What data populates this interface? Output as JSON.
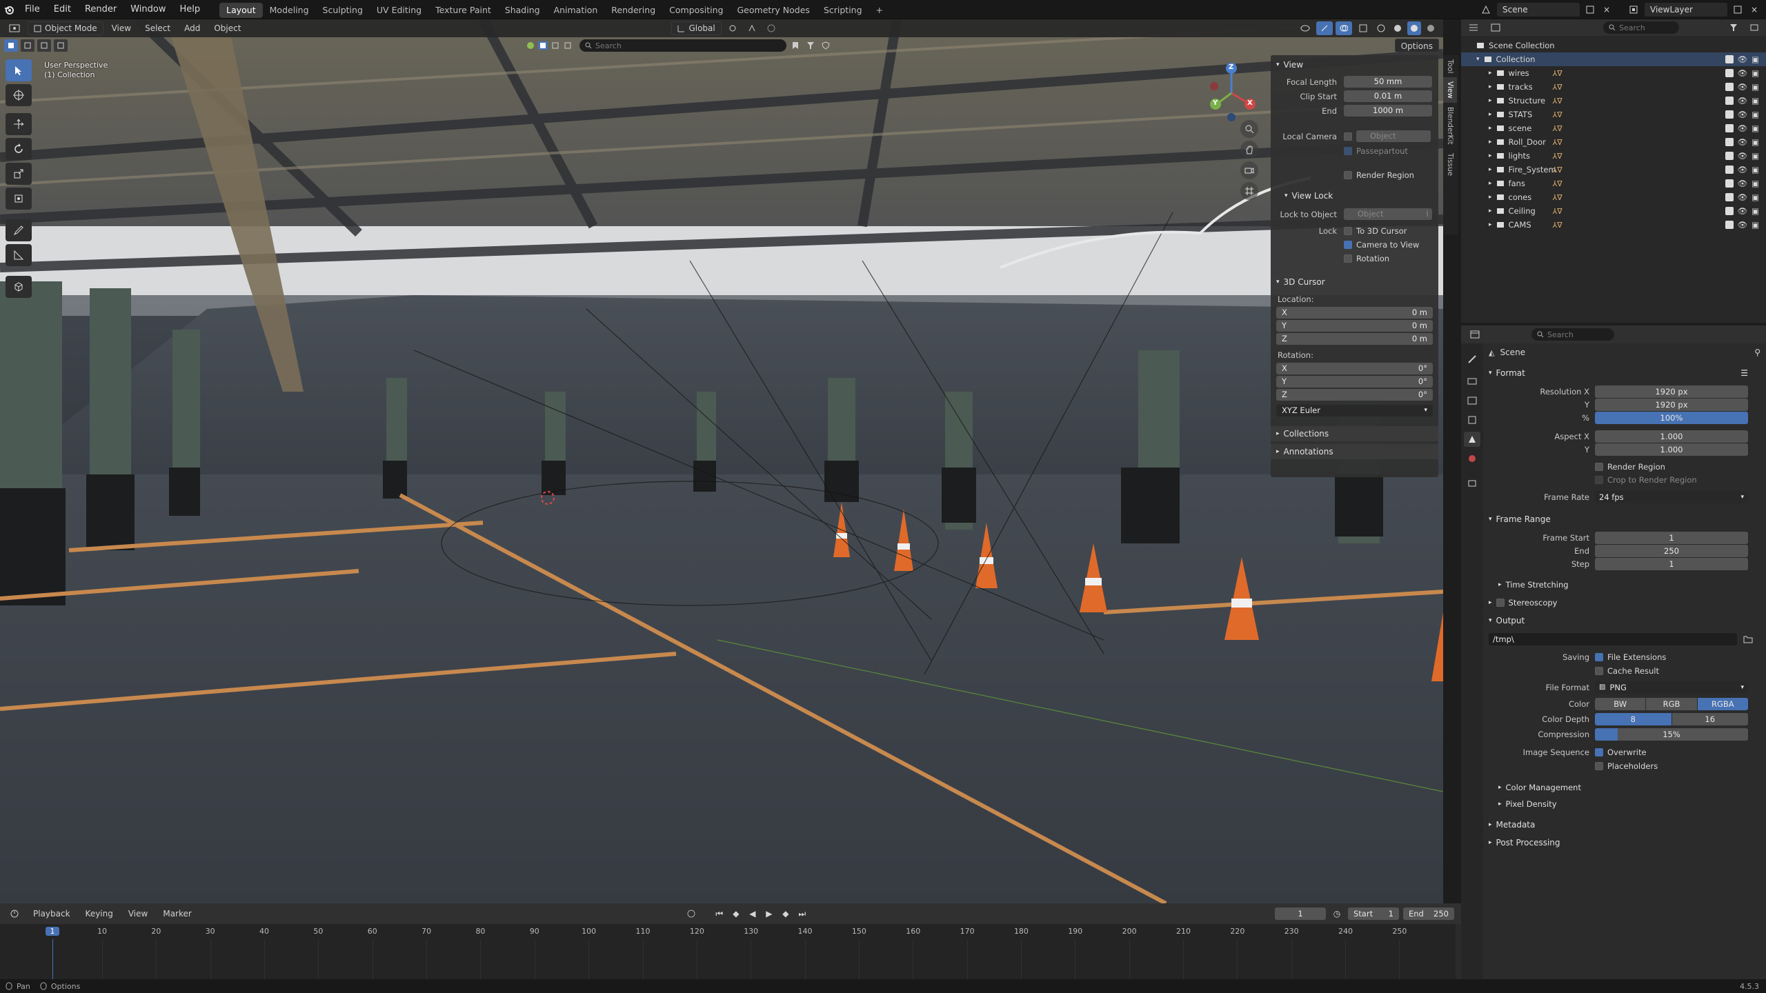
{
  "menu": {
    "items": [
      "File",
      "Edit",
      "Render",
      "Window",
      "Help"
    ]
  },
  "workspaces": [
    "Layout",
    "Modeling",
    "Sculpting",
    "UV Editing",
    "Texture Paint",
    "Shading",
    "Animation",
    "Rendering",
    "Compositing",
    "Geometry Nodes",
    "Scripting"
  ],
  "topbar_right": {
    "scene": "Scene",
    "view_layer": "ViewLayer"
  },
  "viewport": {
    "mode": "Object Mode",
    "menus": [
      "View",
      "Select",
      "Add",
      "Object"
    ],
    "orientation": "Global",
    "search_placeholder": "Search",
    "options": "Options",
    "overlay_text_1": "User Perspective",
    "overlay_text_2": "(1) Collection",
    "side_tabs": [
      "Tool",
      "View",
      "BlenderKit",
      "Tissue"
    ],
    "gizmo_axes": {
      "x": "X",
      "y": "Y",
      "z": "Z"
    }
  },
  "npanel": {
    "view_header": "View",
    "focal_length": {
      "label": "Focal Length",
      "value": "50 mm"
    },
    "clip_start": {
      "label": "Clip Start",
      "value": "0.01 m"
    },
    "clip_end": {
      "label": "End",
      "value": "1000 m"
    },
    "local_camera": {
      "label": "Local Camera",
      "value": "Object"
    },
    "passepartout": "Passepartout",
    "render_region": "Render Region",
    "view_lock_header": "View Lock",
    "lock_to_object": {
      "label": "Lock to Object",
      "value": "Object"
    },
    "lock_label": "Lock",
    "lock_opts": [
      {
        "label": "To 3D Cursor",
        "checked": false
      },
      {
        "label": "Camera to View",
        "checked": true
      },
      {
        "label": "Rotation",
        "checked": false
      }
    ],
    "cursor_header": "3D Cursor",
    "location_label": "Location:",
    "location": [
      {
        "axis": "X",
        "value": "0 m"
      },
      {
        "axis": "Y",
        "value": "0 m"
      },
      {
        "axis": "Z",
        "value": "0 m"
      }
    ],
    "rotation_label": "Rotation:",
    "rotation": [
      {
        "axis": "X",
        "value": "0°"
      },
      {
        "axis": "Y",
        "value": "0°"
      },
      {
        "axis": "Z",
        "value": "0°"
      }
    ],
    "rotation_mode": "XYZ Euler",
    "collections_header": "Collections",
    "annotations_header": "Annotations"
  },
  "outliner": {
    "search_placeholder": "Search",
    "root": "Scene Collection",
    "collection": "Collection",
    "items": [
      "wires",
      "tracks",
      "Structure",
      "STATS",
      "scene",
      "Roll_Door",
      "lights",
      "Fire_System",
      "fans",
      "cones",
      "Ceiling",
      "CAMS"
    ]
  },
  "properties": {
    "search_placeholder": "Search",
    "breadcrumb": "Scene",
    "format_header": "Format",
    "resolution_x": {
      "label": "Resolution X",
      "value": "1920 px"
    },
    "resolution_y": {
      "label": "Y",
      "value": "1920 px"
    },
    "resolution_pct": {
      "label": "%",
      "value": "100%"
    },
    "aspect_x": {
      "label": "Aspect X",
      "value": "1.000"
    },
    "aspect_y": {
      "label": "Y",
      "value": "1.000"
    },
    "render_region": "Render Region",
    "crop_region": "Crop to Render Region",
    "frame_rate": {
      "label": "Frame Rate",
      "value": "24 fps"
    },
    "frame_range_header": "Frame Range",
    "frame_start": {
      "label": "Frame Start",
      "value": "1"
    },
    "frame_end": {
      "label": "End",
      "value": "250"
    },
    "frame_step": {
      "label": "Step",
      "value": "1"
    },
    "time_stretching": "Time Stretching",
    "stereoscopy": "Stereoscopy",
    "output_header": "Output",
    "output_path": "/tmp\\",
    "saving_label": "Saving",
    "file_extensions": "File Extensions",
    "cache_result": "Cache Result",
    "file_format": {
      "label": "File Format",
      "value": "PNG"
    },
    "color": {
      "label": "Color",
      "options": [
        "BW",
        "RGB",
        "RGBA"
      ],
      "selected": "RGBA"
    },
    "color_depth": {
      "label": "Color Depth",
      "options": [
        "8",
        "16"
      ],
      "selected": "8"
    },
    "compression": {
      "label": "Compression",
      "value": "15%",
      "fraction": 0.15
    },
    "image_sequence": "Image Sequence",
    "overwrite": "Overwrite",
    "placeholders": "Placeholders",
    "color_management": "Color Management",
    "pixel_density": "Pixel Density",
    "metadata": "Metadata",
    "post_processing": "Post Processing"
  },
  "timeline": {
    "menus": [
      "Playback",
      "Keying",
      "View",
      "Marker"
    ],
    "current_frame": "1",
    "start": {
      "label": "Start",
      "value": "1"
    },
    "end": {
      "label": "End",
      "value": "250"
    },
    "ticks": [
      "1",
      "10",
      "20",
      "30",
      "40",
      "50",
      "60",
      "70",
      "80",
      "90",
      "100",
      "110",
      "120",
      "130",
      "140",
      "150",
      "160",
      "170",
      "180",
      "190",
      "200",
      "210",
      "220",
      "230",
      "240",
      "250"
    ]
  },
  "statusbar": {
    "left_1": "Pan",
    "left_2": "Options",
    "version": "4.5.3"
  },
  "colors": {
    "accent": "#4772b3",
    "floor": "#3d4249",
    "stripe": "#c8894e",
    "cone": "#e06a2a"
  }
}
